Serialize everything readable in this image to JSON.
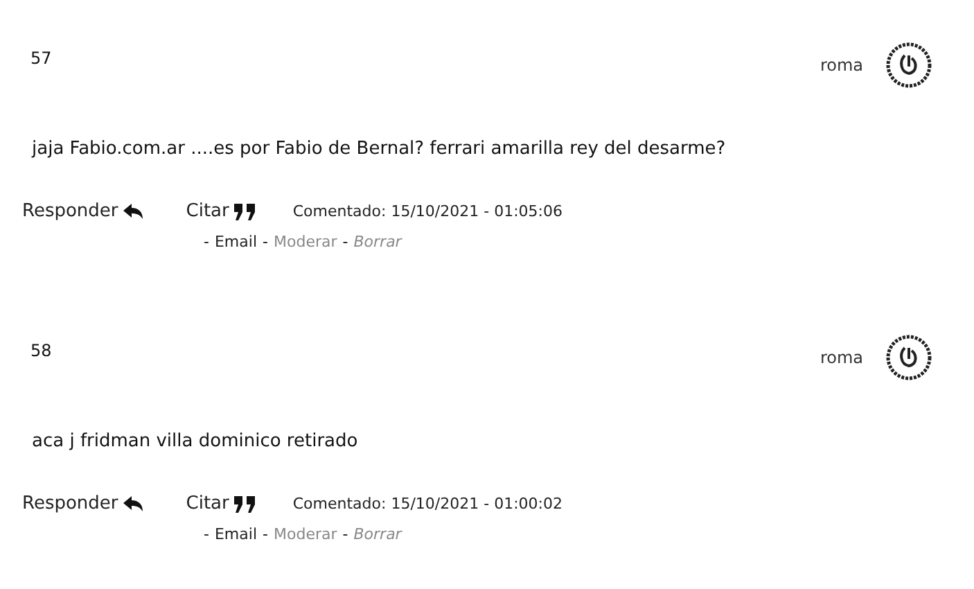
{
  "comments": [
    {
      "number": "57",
      "user": "roma",
      "text": "jaja Fabio.com.ar ....es por Fabio de Bernal? ferrari amarilla rey del desarme?",
      "reply": "Responder",
      "quote": "Citar",
      "posted": "Comentado: 15/10/2021 - 01:05:06",
      "links": [
        {
          "prefix": "-",
          "label": "Email",
          "kind": "plain"
        },
        {
          "prefix": "-",
          "label": "Moderar",
          "kind": "muted"
        },
        {
          "prefix": "-",
          "label": "Borrar",
          "kind": "italic"
        }
      ]
    },
    {
      "number": "58",
      "user": "roma",
      "text": "aca j fridman villa dominico retirado",
      "reply": "Responder",
      "quote": "Citar",
      "posted": "Comentado: 15/10/2021 - 01:00:02",
      "links": [
        {
          "prefix": "-",
          "label": "Email",
          "kind": "plain"
        },
        {
          "prefix": "-",
          "label": "Moderar",
          "kind": "muted"
        },
        {
          "prefix": "-",
          "label": "Borrar",
          "kind": "italic"
        }
      ]
    }
  ]
}
